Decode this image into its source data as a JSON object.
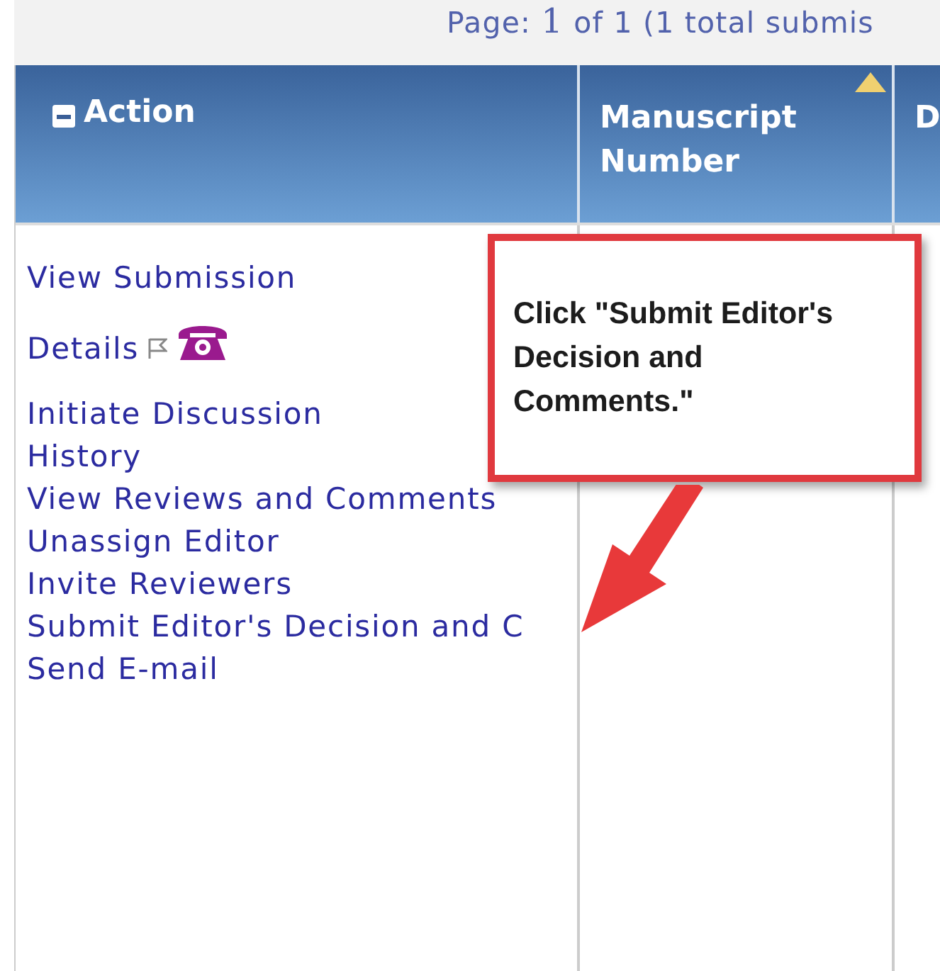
{
  "pager": {
    "text": "Page: **1** of 1 (1 total submis"
  },
  "table": {
    "columns": [
      {
        "label": "Action",
        "kind": "collapse"
      },
      {
        "label": "Manuscript Number",
        "kind": "sorted"
      },
      {
        "label": "D",
        "kind": "plain"
      }
    ],
    "rows": [
      {
        "actions": [
          {
            "label": "View Submission",
            "kind": "link"
          },
          {
            "label": "Details",
            "kind": "details"
          },
          {
            "label": "Initiate Discussion",
            "kind": "link"
          },
          {
            "label": "History",
            "kind": "link"
          },
          {
            "label": "View Reviews and Comments",
            "kind": "link"
          },
          {
            "label": "Unassign Editor",
            "kind": "link"
          },
          {
            "label": "Invite Reviewers",
            "kind": "link"
          },
          {
            "label": "Submit Editor's Decision and C",
            "kind": "link"
          },
          {
            "label": "Send E-mail",
            "kind": "link"
          }
        ]
      }
    ]
  },
  "callout": {
    "text": "Click \"Submit Editor's Decision and Comments.\""
  }
}
